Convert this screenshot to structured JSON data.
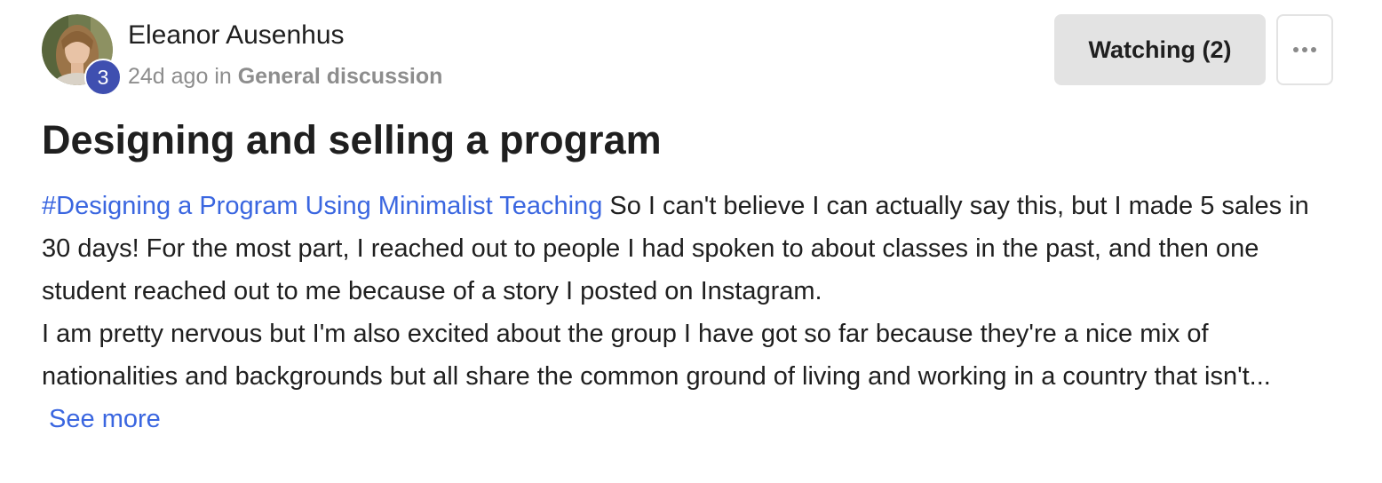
{
  "post": {
    "author": {
      "name": "Eleanor Ausenhus",
      "level": "3",
      "avatar_icon": "user-photo"
    },
    "time_ago": "24d ago",
    "in_label": " in ",
    "category": "General discussion",
    "watch_label": "Watching (2)",
    "more_icon": "more-horizontal-icon",
    "title": "Designing and selling a program",
    "body": {
      "hashtag": "#Designing a Program Using Minimalist Teaching",
      "paragraph_1": " So I can't believe I can actually say this, but I made 5 sales in 30 days! For the most part, I reached out to people I had spoken to about classes in the past, and then one student reached out to me because of a story I posted on Instagram.",
      "paragraph_2": "I am pretty nervous but I'm also excited about the group I have got so far because they're a nice mix of nationalities and backgrounds but all share the common ground of living and working in a country that isn't...",
      "see_more": " See more"
    }
  },
  "colors": {
    "link": "#3a66e0",
    "badge": "#3f4fb0",
    "button_bg": "#e3e3e3",
    "muted_text": "#8d8d8d",
    "text": "#1f1f1f"
  }
}
